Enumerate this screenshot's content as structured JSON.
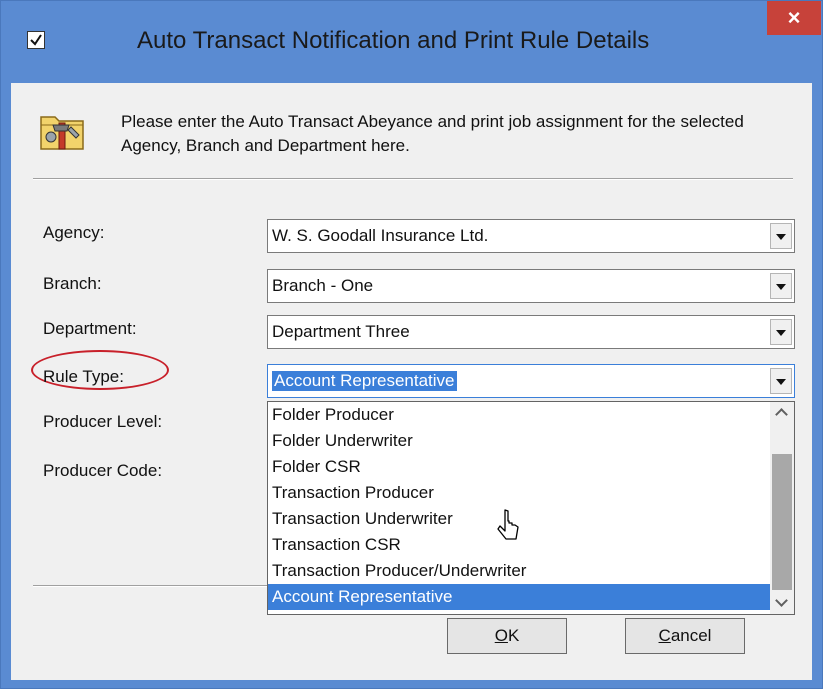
{
  "window": {
    "title": "Auto Transact Notification and Print Rule Details",
    "close_label": "×"
  },
  "header": {
    "text": "Please enter the Auto Transact Abeyance and print job assignment for the selected Agency, Branch and Department here."
  },
  "fields": {
    "agency": {
      "label": "Agency:",
      "value": "W. S. Goodall Insurance Ltd."
    },
    "branch": {
      "label": "Branch:",
      "value": "Branch - One"
    },
    "department": {
      "label": "Department:",
      "value": "Department Three"
    },
    "rule_type": {
      "label": "Rule Type:",
      "value": "Account Representative"
    },
    "producer_level": {
      "label": "Producer Level:"
    },
    "producer_code": {
      "label": "Producer Code:"
    }
  },
  "dropdown": {
    "options": [
      "Folder Producer",
      "Folder Underwriter",
      "Folder CSR",
      "Transaction Producer",
      "Transaction Underwriter",
      "Transaction CSR",
      "Transaction Producer/Underwriter",
      "Account Representative"
    ],
    "selected": "Account Representative"
  },
  "buttons": {
    "ok": {
      "mnemonic": "O",
      "rest": "K"
    },
    "cancel": {
      "mnemonic": "C",
      "rest": "ancel"
    }
  },
  "colors": {
    "title_bar": "#5a8bd2",
    "selection": "#3b7fd9",
    "close": "#c7423a",
    "highlight_circle": "#c8202a"
  }
}
